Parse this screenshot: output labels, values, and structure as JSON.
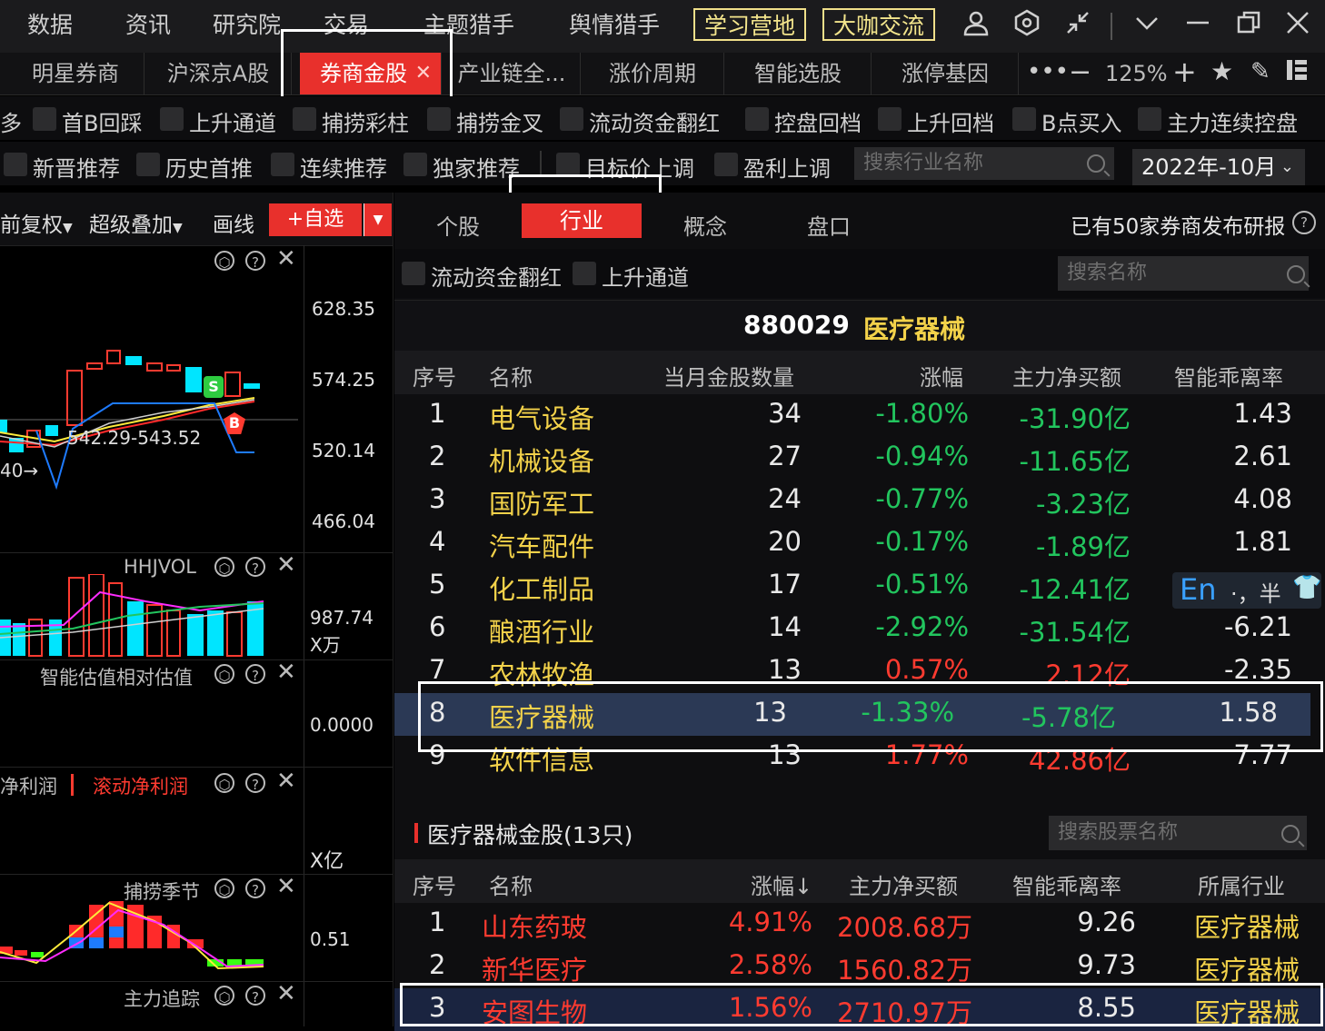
{
  "top_menu": [
    "数据",
    "资讯",
    "研究院",
    "交易",
    "主题猎手",
    "舆情猎手"
  ],
  "top_buttons": [
    "学习营地",
    "大咖交流"
  ],
  "tabs": [
    "明星券商",
    "沪深京A股",
    "券商金股",
    "产业链全...",
    "涨价周期",
    "智能选股",
    "涨停基因"
  ],
  "zoom": "125%",
  "filter_row1": [
    "多",
    "首B回踩",
    "上升通道",
    "捕捞彩柱",
    "捕捞金叉",
    "流动资金翻红",
    "控盘回档",
    "上升回档",
    "B点买入",
    "主力连续控盘"
  ],
  "filter_row2": [
    "新晋推荐",
    "历史首推",
    "连续推荐",
    "独家推荐",
    "目标价上调",
    "盈利上调"
  ],
  "industry_search_placeholder": "搜索行业名称",
  "date_select": "2022年-10月",
  "left_toolbar": {
    "fq": "前复权",
    "overlay": "超级叠加",
    "draw": "画线",
    "add": "+自选"
  },
  "left_axis": {
    "price": [
      "628.35",
      "574.25",
      "520.14",
      "466.04"
    ],
    "price_label": "542.29-543.52",
    "left_arrow": "40→",
    "vol_title": "HHJVOL",
    "vol_val": "987.74",
    "vol_unit": "X万",
    "val_title": "智能估值相对估值",
    "val_val": "0.0000",
    "profit_a": "净利润",
    "profit_b": "滚动净利润",
    "profit_unit": "X亿",
    "season_title": "捕捞季节",
    "season_val": "0.51",
    "track_title": "主力追踪",
    "marker_s": "S",
    "marker_b": "B"
  },
  "view_tabs": [
    "个股",
    "行业",
    "概念",
    "盘口"
  ],
  "report_note": "已有50家券商发布研报",
  "sub_filters": [
    "流动资金翻红",
    "上升通道"
  ],
  "name_search_placeholder": "搜索名称",
  "industry_header": {
    "code": "880029",
    "name": "医疗器械"
  },
  "industry_columns": [
    "序号",
    "名称",
    "当月金股数量",
    "涨幅",
    "主力净买额",
    "智能乖离率"
  ],
  "industry_rows": [
    {
      "no": "1",
      "name": "电气设备",
      "count": "34",
      "chg": "-1.80%",
      "net": "-31.90亿",
      "dev": "1.43"
    },
    {
      "no": "2",
      "name": "机械设备",
      "count": "27",
      "chg": "-0.94%",
      "net": "-11.65亿",
      "dev": "2.61"
    },
    {
      "no": "3",
      "name": "国防军工",
      "count": "24",
      "chg": "-0.77%",
      "net": "-3.23亿",
      "dev": "4.08"
    },
    {
      "no": "4",
      "name": "汽车配件",
      "count": "20",
      "chg": "-0.17%",
      "net": "-1.89亿",
      "dev": "1.81"
    },
    {
      "no": "5",
      "name": "化工制品",
      "count": "17",
      "chg": "-0.51%",
      "net": "-12.41亿",
      "dev": ""
    },
    {
      "no": "6",
      "name": "酿酒行业",
      "count": "14",
      "chg": "-2.92%",
      "net": "-31.54亿",
      "dev": "-6.21"
    },
    {
      "no": "7",
      "name": "农林牧渔",
      "count": "13",
      "chg": "0.57%",
      "net": "2.12亿",
      "dev": "-2.35"
    },
    {
      "no": "8",
      "name": "医疗器械",
      "count": "13",
      "chg": "-1.33%",
      "net": "-5.78亿",
      "dev": "1.58"
    },
    {
      "no": "9",
      "name": "软件信息",
      "count": "13",
      "chg": "1.77%",
      "net": "42.86亿",
      "dev": "7.77"
    }
  ],
  "ime": {
    "en": "En",
    "mid": "·，半"
  },
  "stocks_title": "医疗器械金股(13只)",
  "stock_search_placeholder": "搜索股票名称",
  "stock_columns": [
    "序号",
    "名称",
    "涨幅↓",
    "主力净买额",
    "智能乖离率",
    "所属行业"
  ],
  "stock_rows": [
    {
      "no": "1",
      "name": "山东药玻",
      "chg": "4.91%",
      "net": "2008.68万",
      "dev": "9.26",
      "ind": "医疗器械"
    },
    {
      "no": "2",
      "name": "新华医疗",
      "chg": "2.58%",
      "net": "1560.82万",
      "dev": "9.73",
      "ind": "医疗器械"
    },
    {
      "no": "3",
      "name": "安图生物",
      "chg": "1.56%",
      "net": "2710.97万",
      "dev": "8.55",
      "ind": "医疗器械"
    }
  ],
  "colors": {
    "accent": "#e8302c",
    "up": "#ff3b30",
    "down": "#22c55e",
    "name": "#f3d24a",
    "highlight": "#2b3955"
  }
}
